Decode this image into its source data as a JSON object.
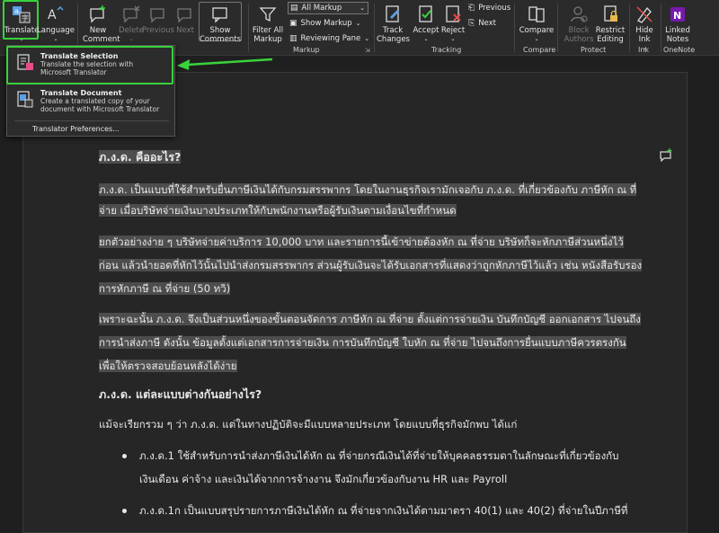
{
  "ribbon": {
    "translate": "Translate",
    "language": "Language",
    "new_comment": "New Comment",
    "delete": "Delete",
    "previous": "Previous",
    "next": "Next",
    "show_comments": "Show Comments",
    "filter_all_markup": "Filter All Markup",
    "all_markup": "All Markup",
    "show_markup": "Show Markup",
    "reviewing_pane": "Reviewing Pane",
    "markup_group": "Markup",
    "track_changes": "Track Changes",
    "accept": "Accept",
    "reject": "Reject",
    "prev_change": "Previous",
    "next_change": "Next",
    "tracking_group": "Tracking",
    "compare": "Compare",
    "compare_group": "Compare",
    "block_authors": "Block Authors",
    "restrict_editing": "Restrict Editing",
    "protect_group": "Protect",
    "hide_ink": "Hide Ink",
    "ink_group": "Ink",
    "linked_notes": "Linked Notes",
    "onenote_group": "OneNote",
    "accent_green": "#39d23c",
    "onenote_color": "#7719aa"
  },
  "dropdown": {
    "item1_title": "Translate Selection",
    "item1_desc1": "Translate the selection with",
    "item1_desc2": "Microsoft Translator",
    "item2_title": "Translate Document",
    "item2_desc1": "Create a translated copy of your",
    "item2_desc2": "document with Microsoft Translator",
    "preferences": "Translator Preferences..."
  },
  "document": {
    "h1": "ภ.ง.ด. คืออะไร?",
    "p1_l1": "ภ.ง.ด. เป็นแบบที่ใช้สำหรับยื่นภาษีเงินได้กับกรมสรรพากร โดยในงานธุรกิจเรามักเจอกับ ภ.ง.ด. ที่เกี่ยวข้องกับ ภาษีหัก ณ ที่",
    "p1_l2": "จ่าย เมื่อบริษัทจ่ายเงินบางประเภทให้กับพนักงานหรือผู้รับเงินตามเงื่อนไขที่กำหนด",
    "p2_l1": "ยกตัวอย่างง่าย ๆ บริษัทจ่ายค่าบริการ 10,000 บาท และรายการนี้เข้าข่ายต้องหัก ณ ที่จ่าย บริษัทก็จะหักภาษีส่วนหนึ่งไว้",
    "p2_l2": "ก่อน แล้วนำยอดที่หักไว้นั้นไปนำส่งกรมสรรพากร ส่วนผู้รับเงินจะได้รับเอกสารที่แสดงว่าถูกหักภาษีไว้แล้ว เช่น หนังสือรับรอง",
    "p2_l3": "การหักภาษี ณ ที่จ่าย (50 ทวิ)",
    "p3_l1": "เพราะฉะนั้น ภ.ง.ด. จึงเป็นส่วนหนึ่งของขั้นตอนจัดการ ภาษีหัก ณ ที่จ่าย ตั้งแต่การจ่ายเงิน บันทึกบัญชี ออกเอกสาร ไปจนถึง",
    "p3_l2": "การนำส่งภาษี ดังนั้น ข้อมูลตั้งแต่เอกสารการจ่ายเงิน การบันทึกบัญชี ใบหัก ณ ที่จ่าย ไปจนถึงการยื่นแบบภาษีควรตรงกัน",
    "p3_l3": "เพื่อให้ตรวจสอบย้อนหลังได้ง่าย",
    "h2": "ภ.ง.ด. แต่ละแบบต่างกันอย่างไร?",
    "p4": "แม้จะเรียกรวม ๆ ว่า ภ.ง.ด. แต่ในทางปฏิบัติจะมีแบบหลายประเภท โดยแบบที่ธุรกิจมักพบ ได้แก่",
    "b1_l1": "ภ.ง.ด.1 ใช้สำหรับการนำส่งภาษีเงินได้หัก ณ ที่จ่ายกรณีเงินได้ที่จ่ายให้บุคคลธรรมดาในลักษณะที่เกี่ยวข้องกับ",
    "b1_l2": "เงินเดือน ค่าจ้าง และเงินได้จากการจ้างงาน จึงมักเกี่ยวข้องกับงาน HR และ Payroll",
    "b2_l1": "ภ.ง.ด.1ก เป็นแบบสรุปรายการภาษีเงินได้หัก ณ ที่จ่ายจากเงินได้ตามมาตรา 40(1) และ 40(2) ที่จ่ายในปีภาษีที่"
  }
}
